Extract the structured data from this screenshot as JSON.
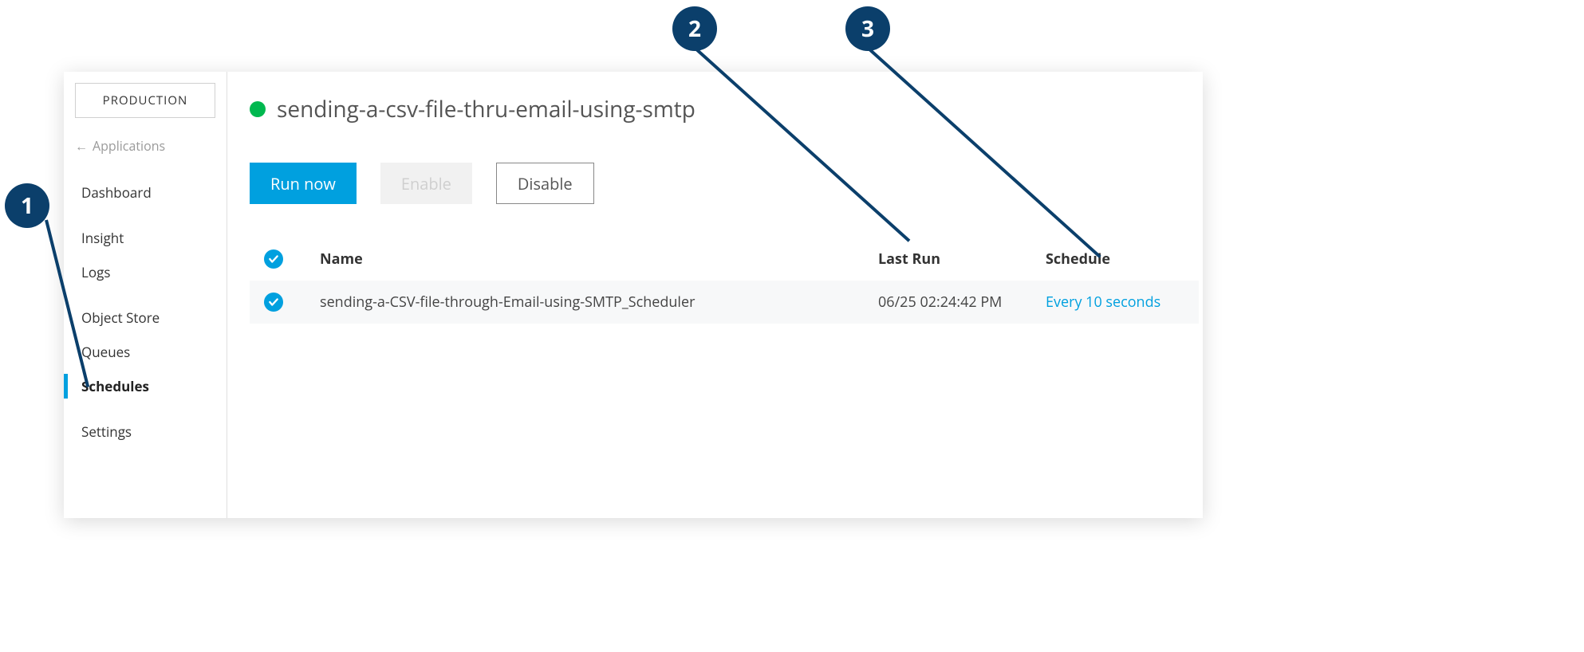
{
  "sidebar": {
    "env_label": "PRODUCTION",
    "back_label": "Applications",
    "items": [
      {
        "label": "Dashboard",
        "active": false
      },
      {
        "label": "Insight",
        "active": false
      },
      {
        "label": "Logs",
        "active": false
      },
      {
        "label": "Object Store",
        "active": false
      },
      {
        "label": "Queues",
        "active": false
      },
      {
        "label": "Schedules",
        "active": true
      },
      {
        "label": "Settings",
        "active": false
      }
    ]
  },
  "header": {
    "title": "sending-a-csv-file-thru-email-using-smtp"
  },
  "actions": {
    "run_now": "Run now",
    "enable": "Enable",
    "disable": "Disable"
  },
  "table": {
    "columns": {
      "name": "Name",
      "last_run": "Last Run",
      "schedule": "Schedule"
    },
    "rows": [
      {
        "name": "sending-a-CSV-file-through-Email-using-SMTP_Scheduler",
        "last_run": "06/25 02:24:42 PM",
        "schedule": "Every 10 seconds"
      }
    ]
  },
  "annotations": {
    "c1": "1",
    "c2": "2",
    "c3": "3"
  }
}
